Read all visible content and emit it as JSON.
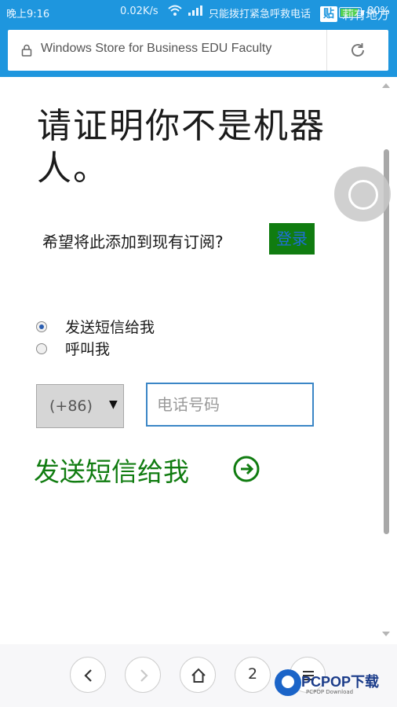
{
  "status_bar": {
    "time": "晚上9:16",
    "net_speed": "0.02K/s",
    "carrier_text": "只能拨打紧急呼救电话",
    "battery": "80%"
  },
  "overlay": {
    "badge": "贴",
    "text": "莉有地方"
  },
  "url_bar": {
    "title": "Windows Store for Business EDU Faculty"
  },
  "page": {
    "title": "请证明你不是机器人。",
    "prompt": "希望将此添加到现有订阅?",
    "login_label": "登录",
    "radio_options": [
      "发送短信给我",
      "呼叫我"
    ],
    "country_code": "(+86)",
    "phone_placeholder": "电话号码",
    "send_label": "发送短信给我"
  },
  "bottom_nav": {
    "tab_count": "2"
  },
  "watermark": {
    "brand": "PCPOP下载",
    "sub": "PCPOP Download"
  },
  "colors": {
    "accent": "#1e96de",
    "green": "#107c10"
  }
}
